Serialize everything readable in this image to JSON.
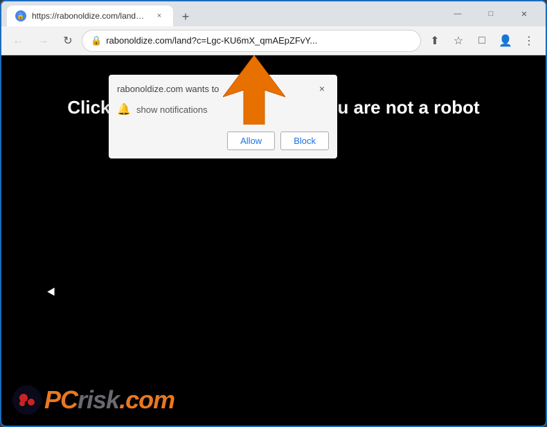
{
  "browser": {
    "tab": {
      "favicon": "🔒",
      "title": "https://rabonoldize.com/land?c=",
      "close_label": "×"
    },
    "new_tab_label": "+",
    "window_controls": {
      "minimize": "—",
      "maximize": "□",
      "close": "✕"
    },
    "toolbar": {
      "back": "←",
      "forward": "→",
      "refresh": "↻",
      "address": "rabonoldize.com/land?c=Lgc-KU6mX_qmAEpZFvY...",
      "share_icon": "⬆",
      "bookmark_icon": "☆",
      "extensions_icon": "□",
      "profile_icon": "👤",
      "menu_icon": "⋮"
    }
  },
  "page": {
    "background_color": "#000000",
    "main_text": "Click \"Allow\" to confirm that you are not a robot"
  },
  "dialog": {
    "title": "rabonoldize.com wants to",
    "notification_text": "show notifications",
    "close_label": "×",
    "allow_label": "Allow",
    "block_label": "Block"
  },
  "logo": {
    "text_pc": "PC",
    "text_risk": "risk",
    "dot_com": ".com"
  }
}
